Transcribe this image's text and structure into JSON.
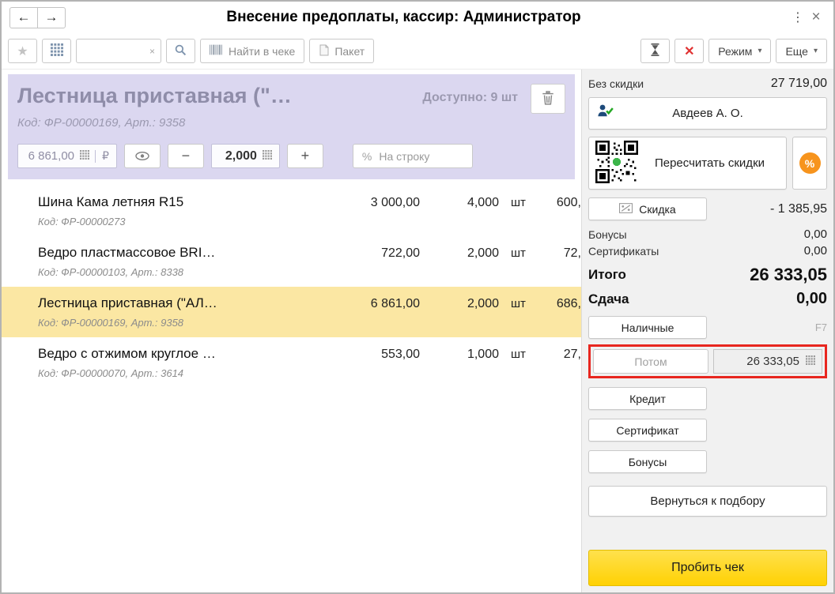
{
  "window": {
    "title": "Внесение предоплаты, кассир: Администратор"
  },
  "titlebar": {
    "back": "←",
    "forward": "→",
    "menu": "⋮",
    "close": "×"
  },
  "toolbar": {
    "star": "★",
    "clear": "×",
    "find_in_check": "Найти в чеке",
    "package": "Пакет",
    "mode": "Режим",
    "more": "Еще",
    "caret": "▾"
  },
  "product": {
    "title": "Лестница приставная (\"…",
    "code": "Код: ФР-00000169, Арт.: 9358",
    "available": "Доступно: 9 шт",
    "price": "6 861,00",
    "currency": "₽",
    "minus": "−",
    "qty": "2,000",
    "plus": "+",
    "percent": "%",
    "per_line_label": "На строку"
  },
  "list": {
    "items": [
      {
        "name": "Шина Кама летняя R15",
        "code": "Код: ФР-00000273",
        "price": "3 000,00",
        "qty": "4,000",
        "unit": "шт",
        "total": "600,"
      },
      {
        "name": "Ведро пластмассовое BRI…",
        "code": "Код: ФР-00000103, Арт.: 8338",
        "price": "722,00",
        "qty": "2,000",
        "unit": "шт",
        "total": "72,"
      },
      {
        "name": "Лестница приставная (\"АЛ…",
        "code": "Код: ФР-00000169, Арт.: 9358",
        "price": "6 861,00",
        "qty": "2,000",
        "unit": "шт",
        "total": "686,"
      },
      {
        "name": "Ведро с отжимом круглое …",
        "code": "Код: ФР-00000070, Арт.: 3614",
        "price": "553,00",
        "qty": "1,000",
        "unit": "шт",
        "total": "27,"
      }
    ]
  },
  "summary": {
    "no_discount_label": "Без скидки",
    "no_discount_value": "27 719,00",
    "client": "Авдеев А. О.",
    "recalc": "Пересчитать скидки",
    "percent": "%",
    "discount_label": "Скидка",
    "discount_value": "- 1 385,95",
    "bonuses_label": "Бонусы",
    "bonuses_value": "0,00",
    "certificates_label": "Сертификаты",
    "certificates_value": "0,00",
    "total_label": "Итого",
    "total_value": "26 333,05",
    "change_label": "Сдача",
    "change_value": "0,00"
  },
  "payments": {
    "cash": "Наличные",
    "cash_hotkey": "F7",
    "later": "Потом",
    "later_value": "26 333,05",
    "credit": "Кредит",
    "certificate": "Сертификат",
    "bonuses": "Бонусы",
    "back_to_selection": "Вернуться к подбору",
    "checkout": "Пробить чек"
  },
  "colors": {
    "accent_yellow": "#ffd200",
    "row_highlight": "#fbe7a3",
    "panel_lavender": "#dbd7f0",
    "annotation_red": "#e8261f"
  }
}
